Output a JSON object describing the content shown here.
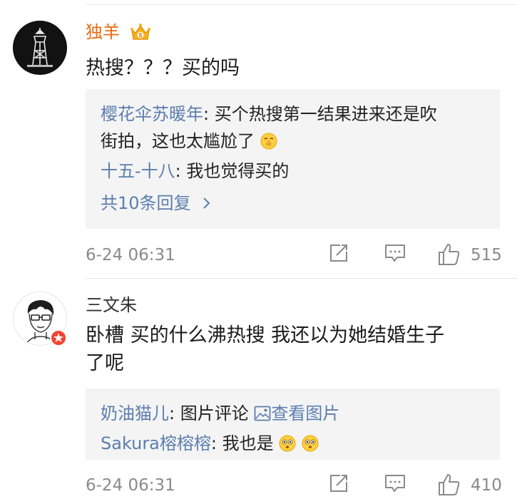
{
  "comments": [
    {
      "username": "独羊",
      "username_color": "#e86a12",
      "avatar_icon": "water-tower-avatar",
      "vip_icon": "vip-crown-icon",
      "content": "热搜？？？买的吗",
      "replies": [
        {
          "user": "樱花伞苏暖年",
          "sep": ": ",
          "text_line1": "买个热搜第一结果进来还是吹",
          "text_line2": "街拍，这也太尴尬了",
          "emoji": "shushing-face-emoji"
        },
        {
          "user": "十五-十八",
          "sep": ": ",
          "text": "我也觉得买的"
        }
      ],
      "more_replies": "共10条回复",
      "time": "6-24 06:31",
      "likes": "515"
    },
    {
      "username": "三文朱",
      "username_color": "#333333",
      "avatar_icon": "sketch-portrait-avatar",
      "badge_icon": "verified-badge-icon",
      "content_line1": "卧槽 买的什么沸热搜 我还以为她结婚生子",
      "content_line2": "了呢",
      "replies": [
        {
          "user": "奶油猫儿",
          "sep": ": ",
          "text": "图片评论 ",
          "link_icon": "image-icon",
          "link": "查看图片"
        },
        {
          "user": "Sakura榕榕榕",
          "sep": ": ",
          "text": "我也是",
          "emoji": "flushed-face-emoji"
        }
      ],
      "time": "6-24 06:31",
      "likes": "410"
    }
  ],
  "colors": {
    "link": "#5b7eae",
    "meta": "#8a8a8a",
    "reply_bg": "#f4f4f4"
  }
}
